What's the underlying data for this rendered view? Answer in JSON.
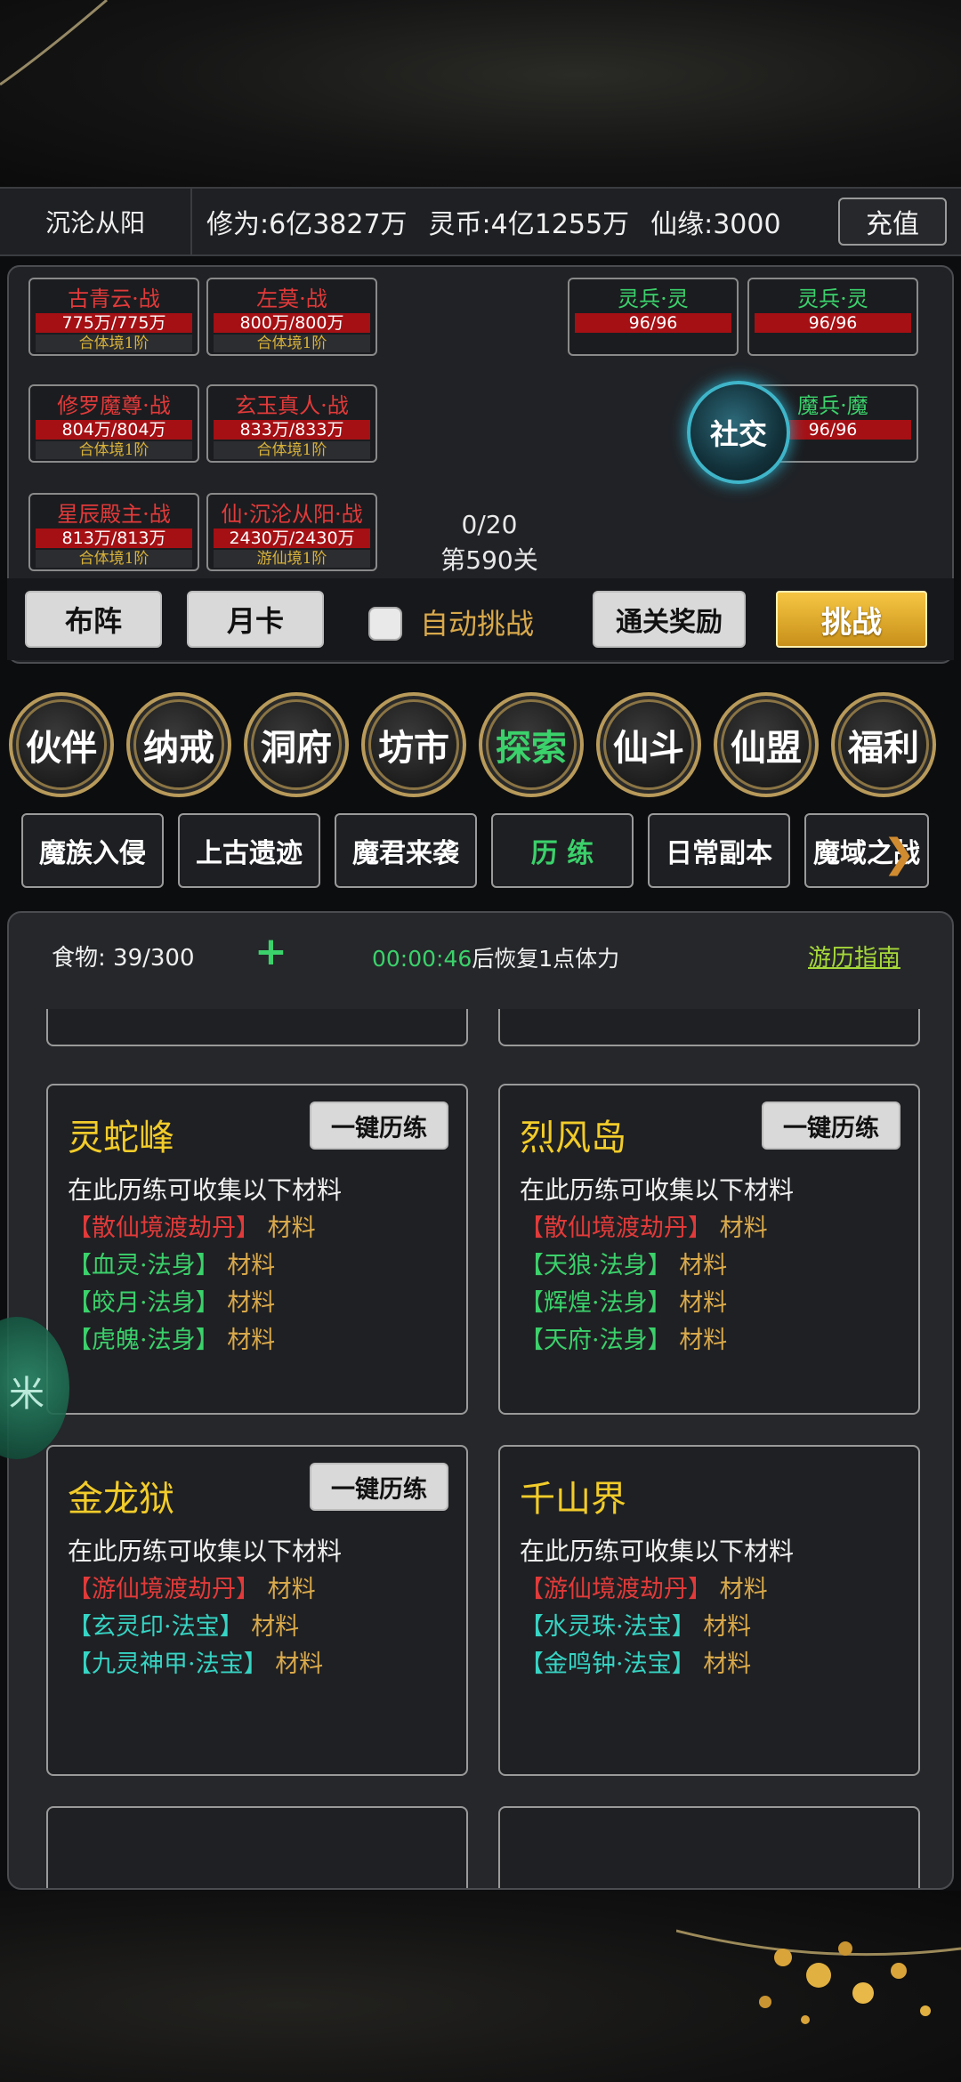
{
  "status": {
    "player_name": "沉沦从阳",
    "cultivation": "修为:6亿3827万",
    "spirit_coin": "灵币:4亿1255万",
    "fate": "仙缘:3000",
    "recharge_label": "充值"
  },
  "battle": {
    "allies": [
      {
        "name": "古青云·战",
        "hp": "775万/775万",
        "realm": "合体境1阶"
      },
      {
        "name": "左莫·战",
        "hp": "800万/800万",
        "realm": "合体境1阶"
      },
      {
        "name": "修罗魔尊·战",
        "hp": "804万/804万",
        "realm": "合体境1阶"
      },
      {
        "name": "玄玉真人·战",
        "hp": "833万/833万",
        "realm": "合体境1阶"
      },
      {
        "name": "星辰殿主·战",
        "hp": "813万/813万",
        "realm": "合体境1阶"
      },
      {
        "name": "仙·沉沦从阳·战",
        "hp": "2430万/2430万",
        "realm": "游仙境1阶"
      }
    ],
    "enemies": [
      {
        "name": "灵兵·灵",
        "hp": "96/96"
      },
      {
        "name": "灵兵·灵",
        "hp": "96/96"
      },
      {
        "name": "魔兵·魔",
        "hp": "96/96"
      }
    ],
    "progress": "0/20",
    "stage": "第590关",
    "social_label": "社交"
  },
  "actions": {
    "formation_label": "布阵",
    "monthly_card_label": "月卡",
    "auto_label": "自动挑战",
    "clear_reward_label": "通关奖励",
    "challenge_label": "挑战"
  },
  "nav": [
    {
      "label": "伙伴"
    },
    {
      "label": "纳戒"
    },
    {
      "label": "洞府"
    },
    {
      "label": "坊市"
    },
    {
      "label": "探索"
    },
    {
      "label": "仙斗"
    },
    {
      "label": "仙盟"
    },
    {
      "label": "福利"
    }
  ],
  "tabs": [
    {
      "label": "魔族入侵"
    },
    {
      "label": "上古遗迹"
    },
    {
      "label": "魔君来袭"
    },
    {
      "label": "历 练"
    },
    {
      "label": "日常副本"
    },
    {
      "label": "魔域之战"
    }
  ],
  "explore": {
    "food": "食物: 39/300",
    "timer": "00:00:46",
    "recover_text": "后恢复1点体力",
    "guide_label": "游历指南",
    "card_button": "一键历练",
    "card_desc": "在此历练可收集以下材料",
    "cards": [
      {
        "title": "灵蛇峰",
        "materials": [
          {
            "name": "【散仙境渡劫丹】",
            "suffix": "材料",
            "color": "red"
          },
          {
            "name": "【血灵·法身】",
            "suffix": "材料",
            "color": "green"
          },
          {
            "name": "【皎月·法身】",
            "suffix": "材料",
            "color": "green"
          },
          {
            "name": "【虎魄·法身】",
            "suffix": "材料",
            "color": "green"
          }
        ]
      },
      {
        "title": "烈风岛",
        "materials": [
          {
            "name": "【散仙境渡劫丹】",
            "suffix": "材料",
            "color": "red"
          },
          {
            "name": "【天狼·法身】",
            "suffix": "材料",
            "color": "green"
          },
          {
            "name": "【辉煌·法身】",
            "suffix": "材料",
            "color": "green"
          },
          {
            "name": "【天府·法身】",
            "suffix": "材料",
            "color": "green"
          }
        ]
      },
      {
        "title": "金龙狱",
        "materials": [
          {
            "name": "【游仙境渡劫丹】",
            "suffix": "材料",
            "color": "red"
          },
          {
            "name": "【玄灵印·法宝】",
            "suffix": "材料",
            "color": "cyan"
          },
          {
            "name": "【九灵神甲·法宝】",
            "suffix": "材料",
            "color": "cyan"
          }
        ]
      },
      {
        "title": "千山界",
        "materials": [
          {
            "name": "【游仙境渡劫丹】",
            "suffix": "材料",
            "color": "red"
          },
          {
            "name": "【水灵珠·法宝】",
            "suffix": "材料",
            "color": "cyan"
          },
          {
            "name": "【金鸣钟·法宝】",
            "suffix": "材料",
            "color": "cyan"
          }
        ]
      }
    ]
  },
  "colors": {
    "gold": "#f2cc2a",
    "active_green": "#3bd16b",
    "hp_red": "#a51014",
    "accent_orange": "#d9a94b"
  }
}
